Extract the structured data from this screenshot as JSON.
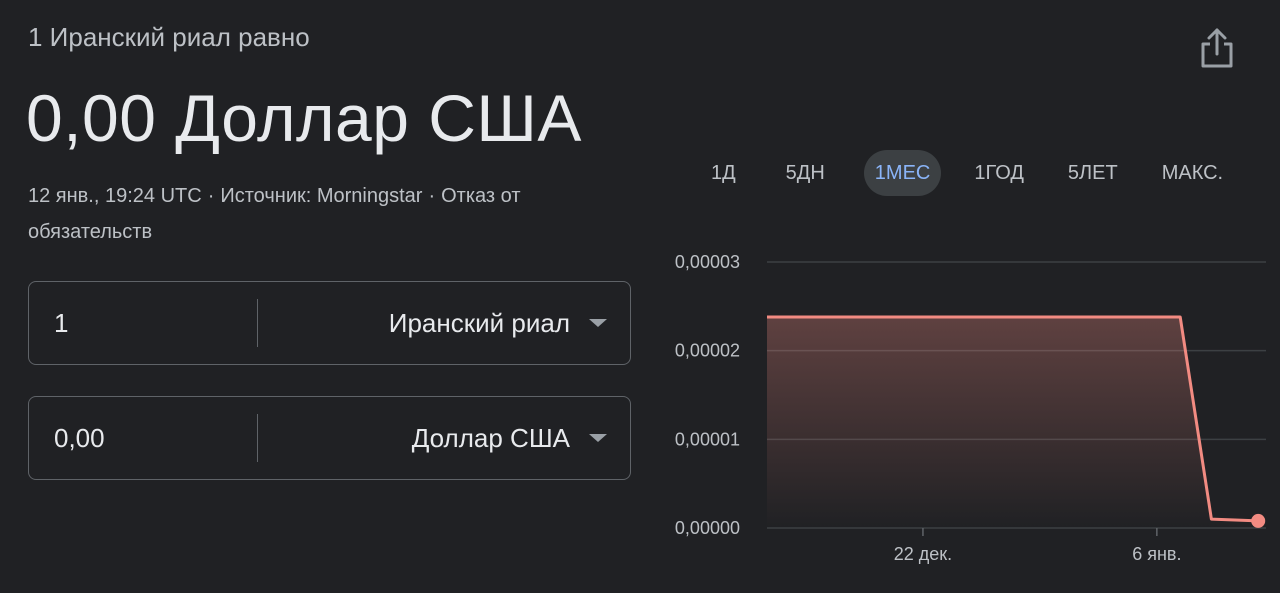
{
  "header": {
    "subtitle": "1 Иранский риал равно",
    "value": "0,00 Доллар США",
    "meta_date": "12 янв., 19:24 UTC",
    "meta_source": "Источник: Morningstar",
    "meta_disclaimer": "Отказ от обязательств"
  },
  "converter": {
    "from": {
      "amount": "1",
      "currency": "Иранский риал"
    },
    "to": {
      "amount": "0,00",
      "currency": "Доллар США"
    }
  },
  "ranges": [
    "1Д",
    "5ДН",
    "1МЕС",
    "1ГОД",
    "5ЛЕТ",
    "МАКС."
  ],
  "active_range": "1МЕС",
  "icons": {
    "share": "share-icon",
    "dropdown": "chevron-down-icon"
  },
  "colors": {
    "background": "#202124",
    "line": "#f28b82",
    "active_range_text": "#8ab4f8",
    "active_range_bg": "#3c4043"
  },
  "chart_data": {
    "type": "area",
    "y_ticks": [
      "0,00003",
      "0,00002",
      "0,00001",
      "0,00000"
    ],
    "ylim": [
      0,
      3e-05
    ],
    "x_ticks": [
      {
        "label": "22 дек.",
        "day": 10
      },
      {
        "label": "6 янв.",
        "day": 25
      }
    ],
    "xlim": [
      0,
      32
    ],
    "series": [
      {
        "points": [
          {
            "day": 0,
            "value": 2.38e-05
          },
          {
            "day": 12,
            "value": 2.38e-05
          },
          {
            "day": 26.5,
            "value": 2.38e-05
          },
          {
            "day": 28.5,
            "value": 1e-06
          },
          {
            "day": 31.5,
            "value": 8e-07
          }
        ]
      }
    ],
    "grid": true
  }
}
